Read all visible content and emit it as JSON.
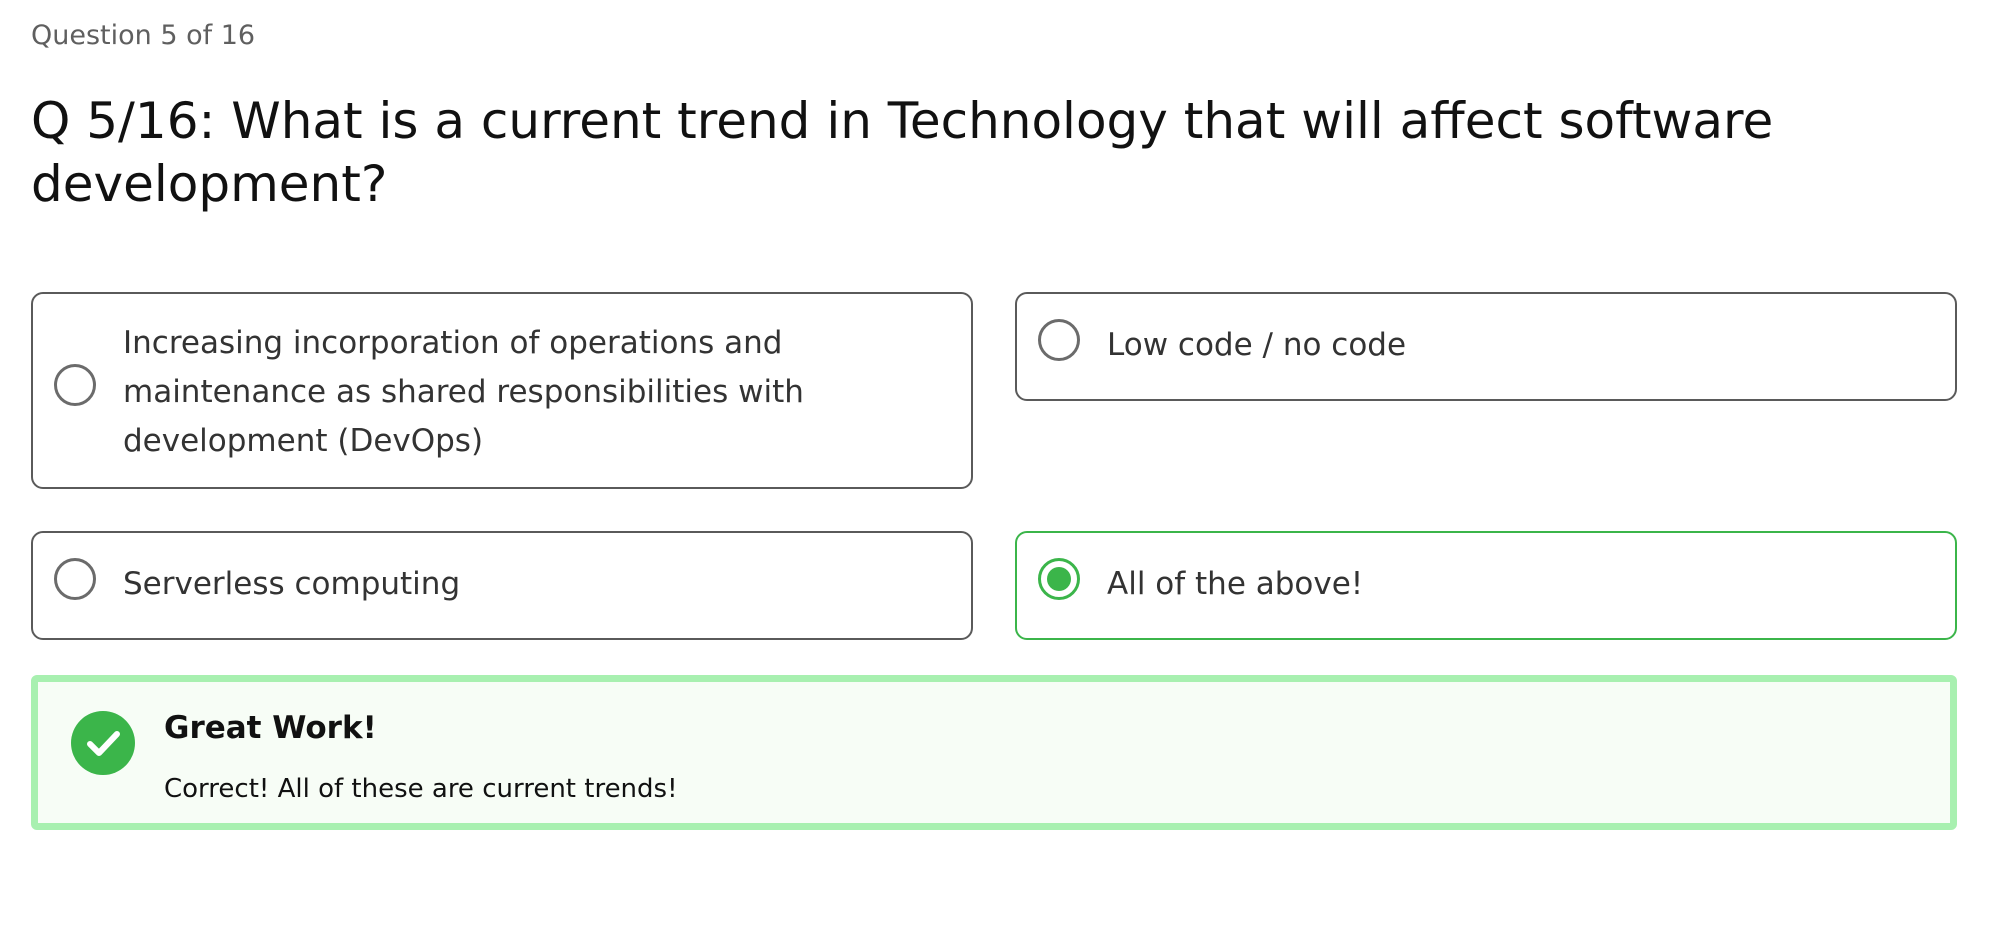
{
  "progress": {
    "label": "Question 5 of 16",
    "current": 5,
    "total": 16
  },
  "question": {
    "text": "Q 5/16: What is a current trend in Technology that will affect software development?"
  },
  "options": [
    {
      "label": "Increasing incorporation of operations and maintenance as shared responsibilities with development (DevOps)",
      "selected": false
    },
    {
      "label": "Low code / no code",
      "selected": false
    },
    {
      "label": "Serverless computing",
      "selected": false
    },
    {
      "label": "All of the above!",
      "selected": true
    }
  ],
  "feedback": {
    "status": "correct",
    "icon": "check-circle-icon",
    "title": "Great Work!",
    "message": "Correct! All of these are current trends!"
  },
  "colors": {
    "accent_green": "#3bb54a",
    "feedback_border": "#a8f0b0",
    "feedback_background": "#f7fdf6",
    "option_border": "#5a5a5a"
  }
}
